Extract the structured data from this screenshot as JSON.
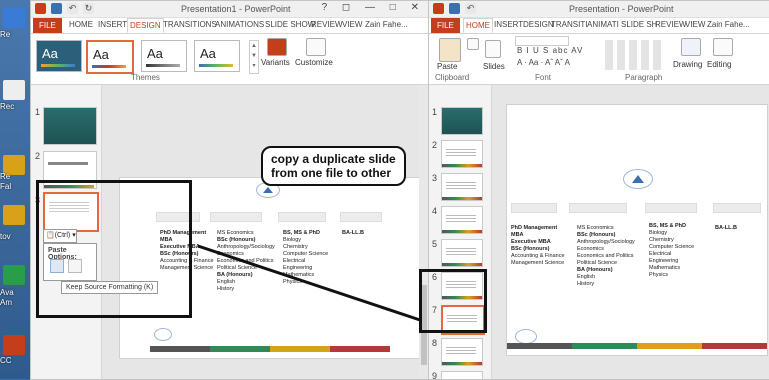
{
  "desktop": {
    "labels": [
      "Re",
      "Rec",
      "Fal",
      "tov",
      "Ava",
      "Am",
      "CC"
    ]
  },
  "left_window": {
    "title": "Presentation1 - PowerPoint",
    "help": "?",
    "tabs": [
      "FILE",
      "HOME",
      "INSERT",
      "DESIGN",
      "TRANSITIONS",
      "ANIMATIONS",
      "SLIDE SHOW",
      "REVIEW",
      "VIEW",
      "Zain Fahe..."
    ],
    "active_tab": "DESIGN",
    "themes": [
      {
        "label": "Aa"
      },
      {
        "label": "Aa"
      },
      {
        "label": "Aa"
      },
      {
        "label": "Aa"
      }
    ],
    "variants_label": "Variants",
    "customize_label": "Customize",
    "themes_group_label": "Themes",
    "thumb_numbers": [
      "1",
      "2",
      "3"
    ],
    "paste_chip": "(Ctrl) ▾",
    "paste_options_title": "Paste Options:",
    "paste_tooltip": "Keep Source Formatting (K)"
  },
  "right_window": {
    "title": "Presentation - PowerPoint",
    "tabs": [
      "FILE",
      "HOME",
      "INSERT",
      "DESIGN",
      "TRANSITI",
      "ANIMATI",
      "SLIDE SH",
      "REVIEW",
      "VIEW",
      "Zain Fahe..."
    ],
    "active_tab": "HOME",
    "paste_label": "Paste",
    "slides_label": "Slides",
    "drawing_label": "Drawing",
    "editing_label": "Editing",
    "group_labels": [
      "Clipboard",
      "Font",
      "Paragraph"
    ],
    "font_row1": "B  I  U  S  abc  AV",
    "font_row2": "A · Aa ·  Aˆ  Aˇ  A",
    "thumb_numbers": [
      "1",
      "2",
      "3",
      "4",
      "5",
      "6",
      "7",
      "8",
      "9"
    ]
  },
  "callout": {
    "line1": "copy a duplicate slide",
    "line2": "from one file to other"
  },
  "slide_content": {
    "col1": [
      [
        "PhD Management",
        true
      ],
      [
        "MBA",
        true
      ],
      [
        "Executive MBA",
        true
      ],
      [
        "BSc (Honours)",
        true
      ],
      [
        "Accounting & Finance",
        false
      ],
      [
        "Management Science",
        false
      ]
    ],
    "col2": [
      [
        "MS Economics",
        false
      ],
      [
        "BSc (Honours)",
        true
      ],
      [
        "Anthropology/Sociology",
        false
      ],
      [
        "Economics",
        false
      ],
      [
        "Economics and Politics",
        false
      ],
      [
        "Political Science",
        false
      ],
      [
        "BA (Honours)",
        true
      ],
      [
        "English",
        false
      ],
      [
        "History",
        false
      ]
    ],
    "col3": [
      [
        "BS, MS & PhD",
        true
      ],
      [
        "Biology",
        false
      ],
      [
        "Chemistry",
        false
      ],
      [
        "Computer Science",
        false
      ],
      [
        "Electrical",
        false
      ],
      [
        "Engineering",
        false
      ],
      [
        "Mathematics",
        false
      ],
      [
        "Physics",
        false
      ]
    ],
    "col4": [
      [
        "BA-LL.B",
        true
      ]
    ]
  },
  "colors": {
    "accent_red": "#c43e1c",
    "selection": "#e06a3a",
    "strip1": "#555555",
    "strip2": "#2e8b57",
    "strip3": "#d9a11a",
    "strip4": "#b33a3a"
  }
}
